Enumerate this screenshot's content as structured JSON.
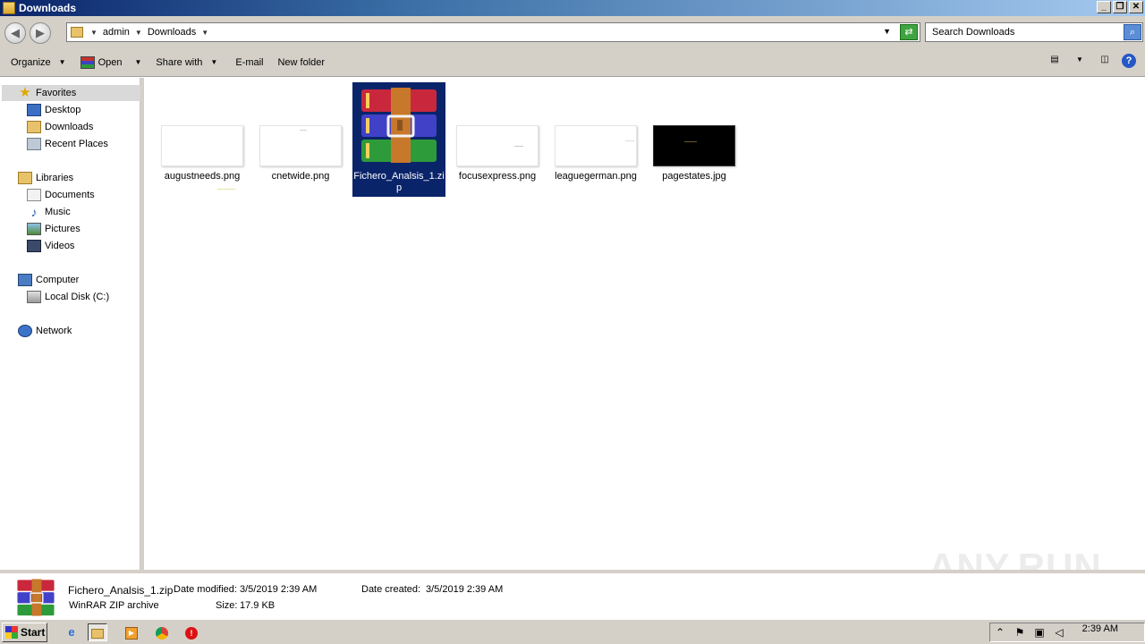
{
  "window": {
    "title": "Downloads"
  },
  "address": {
    "crumbs": [
      "admin",
      "Downloads"
    ]
  },
  "search": {
    "placeholder": "Search Downloads"
  },
  "toolbar": {
    "organize": "Organize",
    "open": "Open",
    "share_with": "Share with",
    "email": "E-mail",
    "new_folder": "New folder"
  },
  "nav": {
    "favorites": "Favorites",
    "desktop": "Desktop",
    "downloads": "Downloads",
    "recent_places": "Recent Places",
    "libraries": "Libraries",
    "documents": "Documents",
    "music": "Music",
    "pictures": "Pictures",
    "videos": "Videos",
    "computer": "Computer",
    "local_disk": "Local Disk (C:)",
    "network": "Network"
  },
  "files": [
    {
      "name": "augustneeds.png"
    },
    {
      "name": "cnetwide.png"
    },
    {
      "name": "Fichero_Analsis_1.zip"
    },
    {
      "name": "focusexpress.png"
    },
    {
      "name": "leaguegerman.png"
    },
    {
      "name": "pagestates.jpg"
    }
  ],
  "details": {
    "name": "Fichero_Analsis_1.zip",
    "type": "WinRAR ZIP archive",
    "modified_label": "Date modified:",
    "modified_value": "3/5/2019 2:39 AM",
    "created_label": "Date created:",
    "created_value": "3/5/2019 2:39 AM",
    "size_label": "Size:",
    "size_value": "17.9 KB"
  },
  "taskbar": {
    "start": "Start",
    "clock": "2:39 AM"
  },
  "watermark": "ANY.RUN",
  "colors": {
    "selection": "#0a246a",
    "chrome": "#d4d0c8"
  }
}
